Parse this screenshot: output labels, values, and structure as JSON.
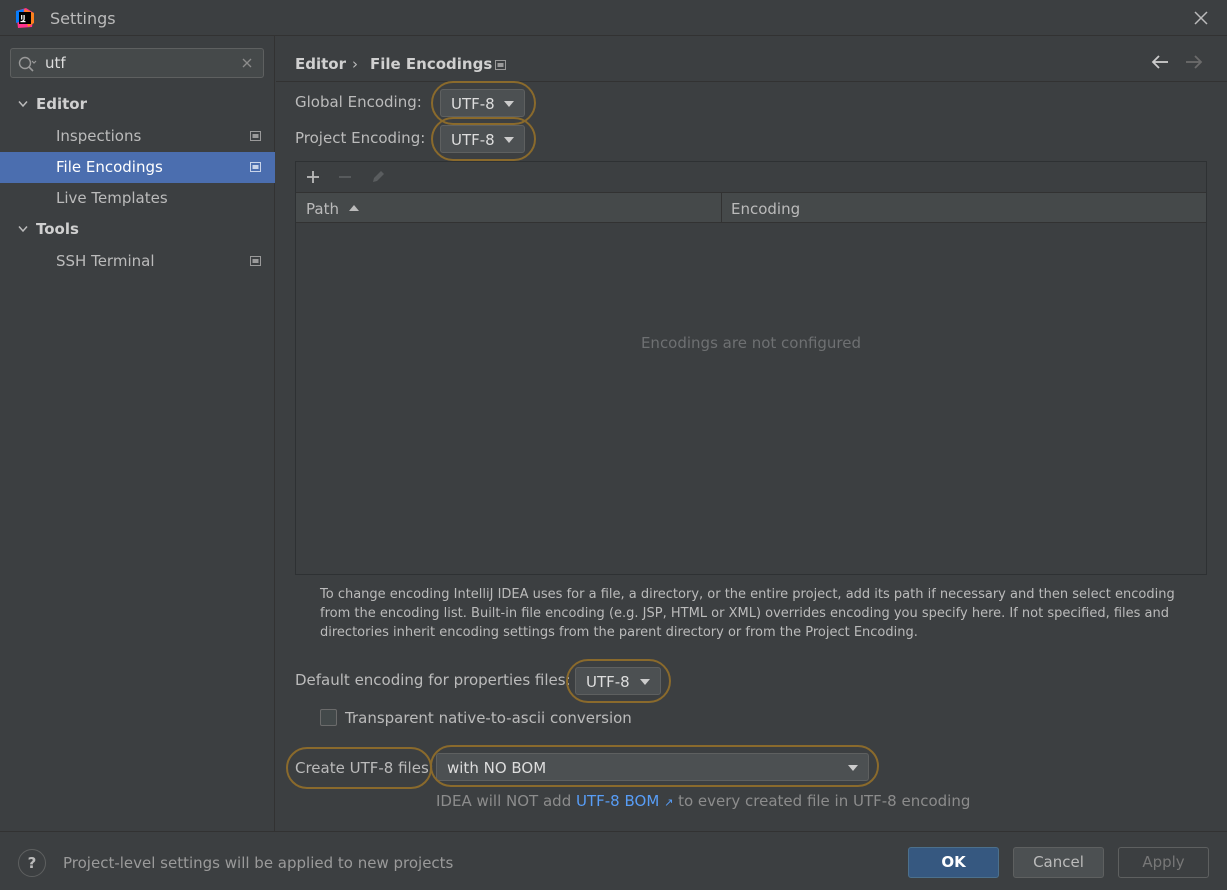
{
  "window": {
    "title": "Settings"
  },
  "search": {
    "value": "utf"
  },
  "sidebar": {
    "items": [
      {
        "label": "Editor",
        "type": "group"
      },
      {
        "label": "Inspections",
        "type": "item"
      },
      {
        "label": "File Encodings",
        "type": "item",
        "selected": true
      },
      {
        "label": "Live Templates",
        "type": "item"
      },
      {
        "label": "Tools",
        "type": "group"
      },
      {
        "label": "SSH Terminal",
        "type": "item"
      }
    ]
  },
  "breadcrumb": {
    "parent": "Editor",
    "separator": "›",
    "current": "File Encodings"
  },
  "form": {
    "global_label": "Global Encoding:",
    "global_value": "UTF-8",
    "project_label": "Project Encoding:",
    "project_value": "UTF-8",
    "table": {
      "columns": [
        "Path",
        "Encoding"
      ],
      "empty_text": "Encodings are not configured",
      "toolbar": [
        "add-icon",
        "remove-icon",
        "edit-icon"
      ]
    },
    "help_text": "To change encoding IntelliJ IDEA uses for a file, a directory, or the entire project, add its path if necessary and then select encoding from the encoding list. Built-in file encoding (e.g. JSP, HTML or XML) overrides encoding you specify here. If not specified, files and directories inherit encoding settings from the parent directory or from the Project Encoding.",
    "properties_label": "Default encoding for properties files:",
    "properties_value": "UTF-8",
    "transparent_label": "Transparent native-to-ascii conversion",
    "transparent_checked": false,
    "create_label": "Create UTF-8 files:",
    "create_value": "with NO BOM",
    "note_prefix": "IDEA will NOT add",
    "note_link": "UTF-8 BOM",
    "note_link_arrow": "↗",
    "note_suffix": "to every created file in UTF-8 encoding"
  },
  "footer": {
    "help_label": "?",
    "status": "Project-level settings will be applied to new projects",
    "ok": "OK",
    "cancel": "Cancel",
    "apply": "Apply"
  },
  "colors": {
    "background": "#3c3f41",
    "selection": "#4b6eaf",
    "highlight_ring": "#8a6a2c",
    "link": "#589df6",
    "primary_button": "#365880"
  }
}
